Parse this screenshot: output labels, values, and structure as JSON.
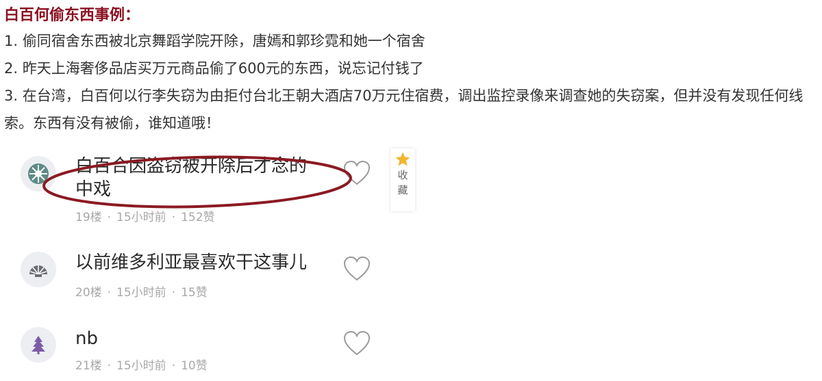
{
  "article": {
    "heading": "白百何偷东西事例：",
    "paragraphs": [
      "1. 偷同宿舍东西被北京舞蹈学院开除，唐嫣和郭珍霓和她一个宿舍",
      "2. 昨天上海奢侈品店买万元商品偷了600元的东西，说忘记付钱了",
      "3. 在台湾，白百何以行李失窃为由拒付台北王朝大酒店70万元住宿费，调出监控录像来调查她的失窃案，但并没有发现任何线索。东西有没有被偷，谁知道哦！"
    ]
  },
  "comments": [
    {
      "text": "白百合因盗窃被开除后才念的中戏",
      "floor": "19楼",
      "time": "15小时前",
      "likes": "152赞"
    },
    {
      "text": "以前维多利亚最喜欢干这事儿",
      "floor": "20楼",
      "time": "15小时前",
      "likes": "15赞"
    },
    {
      "text": "nb",
      "floor": "21楼",
      "time": "15小时前",
      "likes": "10赞"
    }
  ],
  "favorite": {
    "label": "收藏",
    "icon": "star-icon"
  },
  "colors": {
    "heading": "#8b1020",
    "ellipse": "#8b1a22",
    "star": "#f2b530",
    "meta": "#a8a8a8"
  }
}
